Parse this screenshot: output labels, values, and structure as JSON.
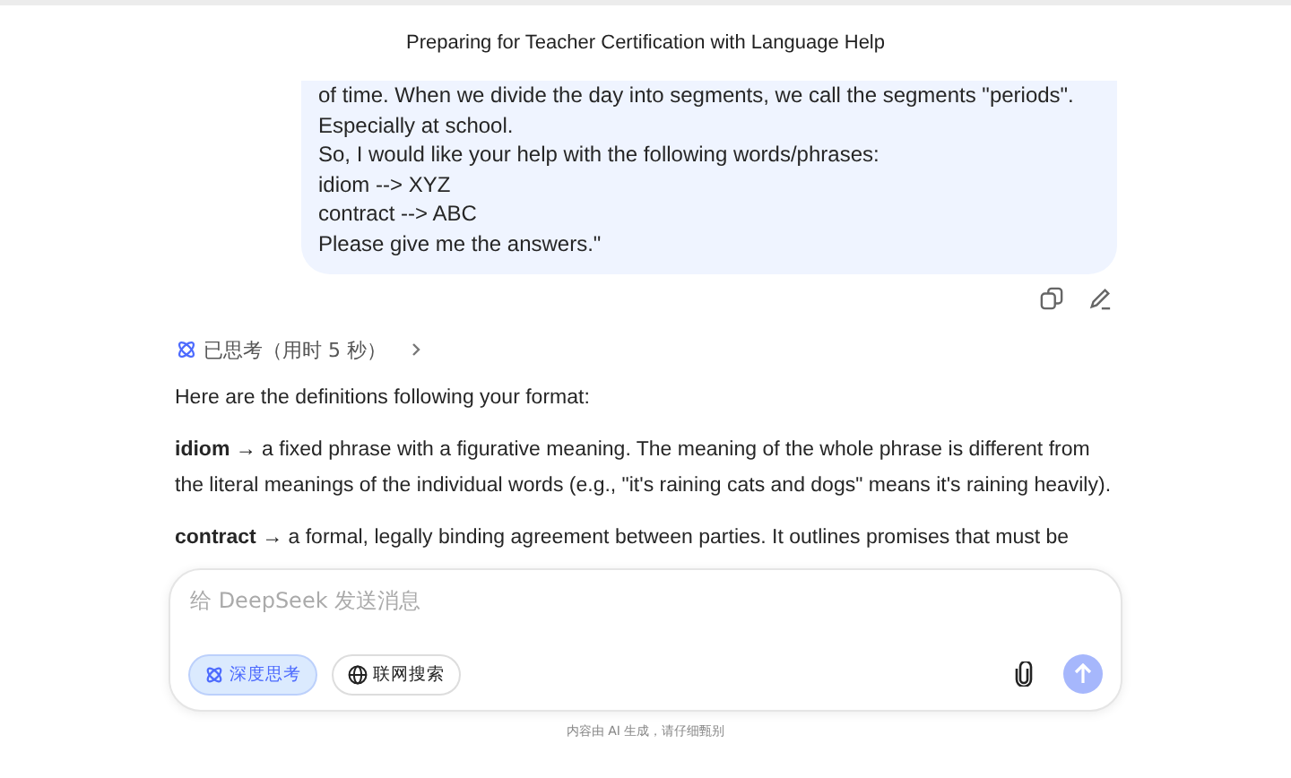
{
  "title": "Preparing for Teacher Certification with Language Help",
  "user_message": {
    "lines": [
      "of time. When we divide the day into segments, we call the segments \"periods\".",
      "Especially at school.",
      "So, I would like your help with the following words/phrases:",
      "idiom --> XYZ",
      "contract --> ABC",
      "Please give me the answers.\""
    ]
  },
  "thinking": {
    "label": "已思考（用时 5 秒）",
    "expanded": false
  },
  "answer": {
    "paragraphs": [
      "Here are the definitions following your format:",
      "**idiom** → a fixed phrase with a figurative meaning. The meaning of the whole phrase is different from the literal meanings of the individual words (e.g., \"it's raining cats and dogs\" means it's raining heavily).",
      "**contract** → a formal, legally binding agreement between parties. It outlines promises that must be"
    ]
  },
  "composer": {
    "placeholder": "给 DeepSeek 发送消息",
    "toggles": [
      {
        "label": "深度思考",
        "kind": "think",
        "selected": true
      },
      {
        "label": "联网搜索",
        "kind": "web",
        "selected": false
      }
    ],
    "send_disabled": true
  },
  "footer": "内容由 AI 生成，请仔细甄别"
}
